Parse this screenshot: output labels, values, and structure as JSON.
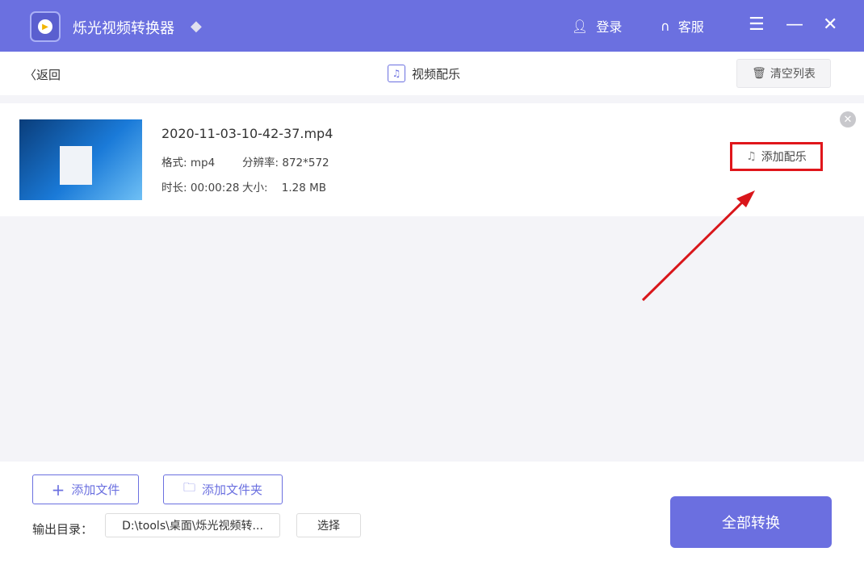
{
  "app": {
    "title": "烁光视频转换器",
    "login": "登录",
    "service": "客服"
  },
  "subbar": {
    "back": "返回",
    "title": "视频配乐",
    "clear": "清空列表"
  },
  "file": {
    "name": "2020-11-03-10-42-37.mp4",
    "format_label": "格式:",
    "format": "mp4",
    "resolution_label": "分辨率:",
    "resolution": "872*572",
    "duration_label": "时长:",
    "duration": "00:00:28",
    "size_label": "大小:",
    "size": "1.28 MB",
    "add_music": "添加配乐"
  },
  "bottom": {
    "add_file": "添加文件",
    "add_folder": "添加文件夹",
    "output_label": "输出目录：",
    "output_path": "D:\\tools\\桌面\\烁光视频转...",
    "choose": "选择",
    "convert_all": "全部转换"
  },
  "colors": {
    "accent": "#6b70e0",
    "highlight": "#e0161b"
  }
}
